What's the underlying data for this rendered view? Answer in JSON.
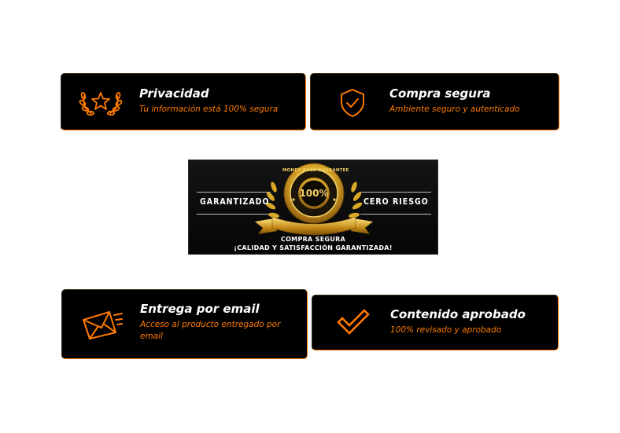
{
  "cards": {
    "privacidad": {
      "title": "Privacidad",
      "subtitle": "Tu información está 100% segura",
      "icon": "laurel-star-icon"
    },
    "compra_segura": {
      "title": "Compra segura",
      "subtitle": "Ambiente seguro y autenticado",
      "icon": "shield-check-icon"
    },
    "entrega_email": {
      "title": "Entrega por email",
      "subtitle": "Acceso al producto entregado por email",
      "icon": "envelope-fast-icon"
    },
    "contenido_aprobado": {
      "title": "Contenido aprobado",
      "subtitle": "100% revisado y aprobado",
      "icon": "checkmark-icon"
    }
  },
  "badge": {
    "left_text": "GARANTIZADO",
    "right_text": "CERO RIESGO",
    "seal_ring_text": "MONEY BACK GUARANTEE",
    "seal_center": "100%",
    "bottom_line1": "COMPRA SEGURA",
    "bottom_line2": "¡CALIDAD Y SATISFACCIÓN GARANTIZADA!"
  },
  "colors": {
    "accent": "#ff7a00",
    "card_bg": "#000000",
    "title_text": "#ffffff",
    "gold": "#d9a826"
  }
}
